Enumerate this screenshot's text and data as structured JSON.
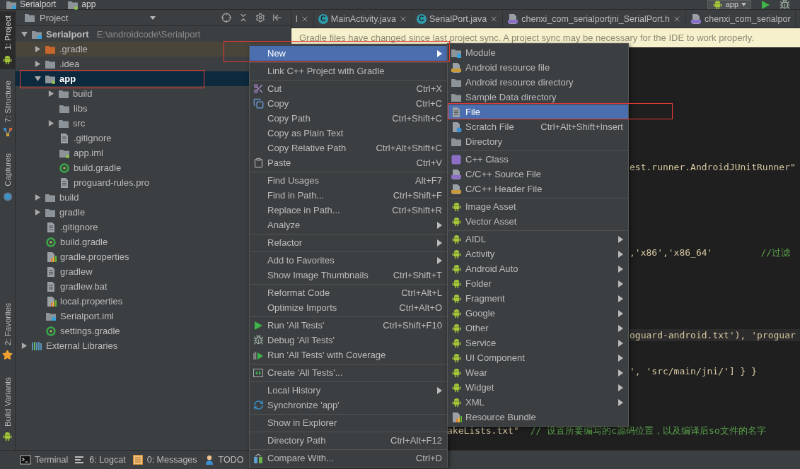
{
  "top_bar": {
    "breadcrumbs": [
      "Serialport",
      "app"
    ],
    "run_config": "app"
  },
  "tool_strip": {
    "top": [
      {
        "label": "1: Project",
        "kind": "android",
        "selected": true
      },
      {
        "label": "7: Structure",
        "kind": "structure",
        "selected": false
      },
      {
        "label": "Captures",
        "kind": "captures",
        "selected": false
      }
    ],
    "bottom": [
      {
        "label": "2: Favorites",
        "kind": "star",
        "selected": false
      },
      {
        "label": "Build Variants",
        "kind": "android",
        "selected": false
      }
    ]
  },
  "project_panel": {
    "title": "Project",
    "tree": [
      {
        "name": "Serialport",
        "path": "E:\\androidcode\\Serialport",
        "kind": "project-folder",
        "expanded": true,
        "selected": false,
        "highlighted": false,
        "children": [
          {
            "name": ".gradle",
            "kind": "excluded-folder",
            "expanded": false,
            "selected": false,
            "highlighted": true
          },
          {
            "name": ".idea",
            "kind": "folder",
            "expanded": false,
            "selected": false,
            "highlighted": false
          },
          {
            "name": "app",
            "kind": "module-folder",
            "expanded": true,
            "selected": true,
            "highlighted": false,
            "children": [
              {
                "name": "build",
                "kind": "folder",
                "expanded": false,
                "selected": false,
                "highlighted": false
              },
              {
                "name": "libs",
                "kind": "folder",
                "selected": false,
                "highlighted": false
              },
              {
                "name": "src",
                "kind": "folder",
                "expanded": false,
                "selected": false,
                "highlighted": false
              },
              {
                "name": ".gitignore",
                "kind": "text-file",
                "selected": false,
                "highlighted": false
              },
              {
                "name": "app.iml",
                "kind": "module-folder",
                "selected": false,
                "highlighted": false
              },
              {
                "name": "build.gradle",
                "kind": "gradle-file",
                "selected": false,
                "highlighted": false
              },
              {
                "name": "proguard-rules.pro",
                "kind": "text-file",
                "selected": false,
                "highlighted": false
              }
            ]
          },
          {
            "name": "build",
            "kind": "folder",
            "expanded": false,
            "selected": false,
            "highlighted": false
          },
          {
            "name": "gradle",
            "kind": "folder",
            "expanded": false,
            "selected": false,
            "highlighted": false
          },
          {
            "name": ".gitignore",
            "kind": "text-file",
            "selected": false,
            "highlighted": false
          },
          {
            "name": "build.gradle",
            "kind": "gradle-file",
            "selected": false,
            "highlighted": false
          },
          {
            "name": "gradle.properties",
            "kind": "properties-file",
            "selected": false,
            "highlighted": false
          },
          {
            "name": "gradlew",
            "kind": "text-file",
            "selected": false,
            "highlighted": false
          },
          {
            "name": "gradlew.bat",
            "kind": "text-file",
            "selected": false,
            "highlighted": false
          },
          {
            "name": "local.properties",
            "kind": "properties-file",
            "selected": false,
            "highlighted": false
          },
          {
            "name": "Serialport.iml",
            "kind": "project-folder",
            "selected": false,
            "highlighted": false
          },
          {
            "name": "settings.gradle",
            "kind": "gradle-file",
            "selected": false,
            "highlighted": false
          }
        ]
      },
      {
        "name": "External Libraries",
        "kind": "libraries",
        "expanded": false,
        "selected": false,
        "highlighted": false
      }
    ]
  },
  "editor": {
    "tabs": [
      {
        "label": "l",
        "kind": "plain",
        "selected": false
      },
      {
        "label": "MainActivity.java",
        "kind": "class",
        "badge": "C",
        "selected": false
      },
      {
        "label": "SerialPort.java",
        "kind": "class",
        "badge": "C",
        "selected": false
      },
      {
        "label": "chenxi_com_serialportjni_SerialPort.h",
        "kind": "header",
        "selected": false
      },
      {
        "label": "chenxi_com_serialpor",
        "kind": "header",
        "selected": false
      }
    ],
    "notification": "Gradle files have changed since last project sync. A project sync may be necessary for the IDE to work properly.",
    "code_lines": [
      {
        "current": false,
        "segments": [
          {
            "text": "est.runner.AndroidJUnitRunner\"",
            "kind": "string"
          }
        ]
      },
      {
        "current": false,
        "segments": [
          {
            "text": ",'x86','x86_64'",
            "kind": "string"
          },
          {
            "text": "//过滤",
            "kind": "comment"
          }
        ]
      },
      {
        "current": true,
        "segments": [
          {
            "text": "oguard-android.txt'), 'proguar",
            "kind": "string"
          }
        ]
      },
      {
        "current": false,
        "segments": [
          {
            "text": "', 'src/main/jni/'] } }",
            "kind": "string"
          }
        ]
      },
      {
        "current": false,
        "segments": [
          {
            "text": "akeLists.txt\"",
            "kind": "string"
          },
          {
            "text": "// 设置所要编写的c源码位置，以及编译后so文件的名字",
            "kind": "comment"
          }
        ]
      }
    ]
  },
  "context_menu": {
    "groups": [
      [
        {
          "label": "New",
          "kind": "plain",
          "submenu": true,
          "selected": true
        }
      ],
      [
        {
          "label": "Link C++ Project with Gradle",
          "kind": "plain",
          "submenu": false,
          "selected": false
        }
      ],
      [
        {
          "label": "Cut",
          "shortcut": "Ctrl+X",
          "kind": "cut",
          "submenu": false,
          "selected": false
        },
        {
          "label": "Copy",
          "shortcut": "Ctrl+C",
          "kind": "copy",
          "submenu": false,
          "selected": false
        },
        {
          "label": "Copy Path",
          "shortcut": "Ctrl+Shift+C",
          "kind": "plain",
          "submenu": false,
          "selected": false
        },
        {
          "label": "Copy as Plain Text",
          "kind": "plain",
          "submenu": false,
          "selected": false
        },
        {
          "label": "Copy Relative Path",
          "shortcut": "Ctrl+Alt+Shift+C",
          "kind": "plain",
          "submenu": false,
          "selected": false
        },
        {
          "label": "Paste",
          "shortcut": "Ctrl+V",
          "kind": "paste",
          "submenu": false,
          "selected": false
        }
      ],
      [
        {
          "label": "Find Usages",
          "shortcut": "Alt+F7",
          "kind": "plain",
          "submenu": false,
          "selected": false
        },
        {
          "label": "Find in Path...",
          "shortcut": "Ctrl+Shift+F",
          "kind": "plain",
          "submenu": false,
          "selected": false
        },
        {
          "label": "Replace in Path...",
          "shortcut": "Ctrl+Shift+R",
          "kind": "plain",
          "submenu": false,
          "selected": false
        },
        {
          "label": "Analyze",
          "kind": "plain",
          "submenu": true,
          "selected": false
        }
      ],
      [
        {
          "label": "Refactor",
          "kind": "plain",
          "submenu": true,
          "selected": false
        }
      ],
      [
        {
          "label": "Add to Favorites",
          "kind": "plain",
          "submenu": true,
          "selected": false
        },
        {
          "label": "Show Image Thumbnails",
          "shortcut": "Ctrl+Shift+T",
          "kind": "plain",
          "submenu": false,
          "selected": false
        }
      ],
      [
        {
          "label": "Reformat Code",
          "shortcut": "Ctrl+Alt+L",
          "kind": "plain",
          "submenu": false,
          "selected": false
        },
        {
          "label": "Optimize Imports",
          "shortcut": "Ctrl+Alt+O",
          "kind": "plain",
          "submenu": false,
          "selected": false
        }
      ],
      [
        {
          "label": "Run 'All Tests'",
          "shortcut": "Ctrl+Shift+F10",
          "kind": "run",
          "submenu": false,
          "selected": false
        },
        {
          "label": "Debug 'All Tests'",
          "kind": "debug",
          "submenu": false,
          "selected": false
        },
        {
          "label": "Run 'All Tests' with Coverage",
          "kind": "coverage",
          "submenu": false,
          "selected": false
        }
      ],
      [
        {
          "label": "Create 'All Tests'...",
          "kind": "create-tests",
          "submenu": false,
          "selected": false
        }
      ],
      [
        {
          "label": "Local History",
          "kind": "plain",
          "submenu": true,
          "selected": false
        },
        {
          "label": "Synchronize 'app'",
          "kind": "sync",
          "submenu": false,
          "selected": false
        }
      ],
      [
        {
          "label": "Show in Explorer",
          "kind": "plain",
          "submenu": false,
          "selected": false
        }
      ],
      [
        {
          "label": "Directory Path",
          "shortcut": "Ctrl+Alt+F12",
          "kind": "plain",
          "submenu": false,
          "selected": false
        }
      ],
      [
        {
          "label": "Compare With...",
          "shortcut": "Ctrl+D",
          "kind": "compare",
          "submenu": false,
          "selected": false
        }
      ]
    ]
  },
  "new_submenu": {
    "groups": [
      [
        {
          "label": "Module",
          "kind": "module",
          "submenu": false,
          "selected": false
        },
        {
          "label": "Android resource file",
          "kind": "res-file",
          "submenu": false,
          "selected": false
        },
        {
          "label": "Android resource directory",
          "kind": "folder",
          "submenu": false,
          "selected": false
        },
        {
          "label": "Sample Data directory",
          "kind": "folder",
          "submenu": false,
          "selected": false
        },
        {
          "label": "File",
          "kind": "file",
          "submenu": false,
          "selected": true
        },
        {
          "label": "Scratch File",
          "shortcut": "Ctrl+Alt+Shift+Insert",
          "kind": "scratch",
          "submenu": false,
          "selected": false
        },
        {
          "label": "Directory",
          "kind": "folder",
          "submenu": false,
          "selected": false
        }
      ],
      [
        {
          "label": "C++ Class",
          "kind": "cpp-class",
          "submenu": false,
          "selected": false
        },
        {
          "label": "C/C++ Source File",
          "kind": "cpp-source",
          "submenu": false,
          "selected": false
        },
        {
          "label": "C/C++ Header File",
          "kind": "cpp-header",
          "submenu": false,
          "selected": false
        }
      ],
      [
        {
          "label": "Image Asset",
          "kind": "android",
          "submenu": false,
          "selected": false
        },
        {
          "label": "Vector Asset",
          "kind": "android",
          "submenu": false,
          "selected": false
        }
      ],
      [
        {
          "label": "AIDL",
          "kind": "android",
          "submenu": true,
          "selected": false
        },
        {
          "label": "Activity",
          "kind": "android",
          "submenu": true,
          "selected": false
        },
        {
          "label": "Android Auto",
          "kind": "android",
          "submenu": true,
          "selected": false
        },
        {
          "label": "Folder",
          "kind": "android",
          "submenu": true,
          "selected": false
        },
        {
          "label": "Fragment",
          "kind": "android",
          "submenu": true,
          "selected": false
        },
        {
          "label": "Google",
          "kind": "android",
          "submenu": true,
          "selected": false
        },
        {
          "label": "Other",
          "kind": "android",
          "submenu": true,
          "selected": false
        },
        {
          "label": "Service",
          "kind": "android",
          "submenu": true,
          "selected": false
        },
        {
          "label": "UI Component",
          "kind": "android",
          "submenu": true,
          "selected": false
        },
        {
          "label": "Wear",
          "kind": "android",
          "submenu": true,
          "selected": false
        },
        {
          "label": "Widget",
          "kind": "android",
          "submenu": true,
          "selected": false
        },
        {
          "label": "XML",
          "kind": "android",
          "submenu": true,
          "selected": false
        },
        {
          "label": "Resource Bundle",
          "kind": "bundle",
          "submenu": false,
          "selected": false
        }
      ]
    ]
  },
  "bottom_bar": [
    {
      "label": "Terminal",
      "kind": "terminal"
    },
    {
      "label": "6: Logcat",
      "kind": "logcat"
    },
    {
      "label": "0: Messages",
      "kind": "messages"
    },
    {
      "label": "TODO",
      "kind": "todo"
    }
  ]
}
